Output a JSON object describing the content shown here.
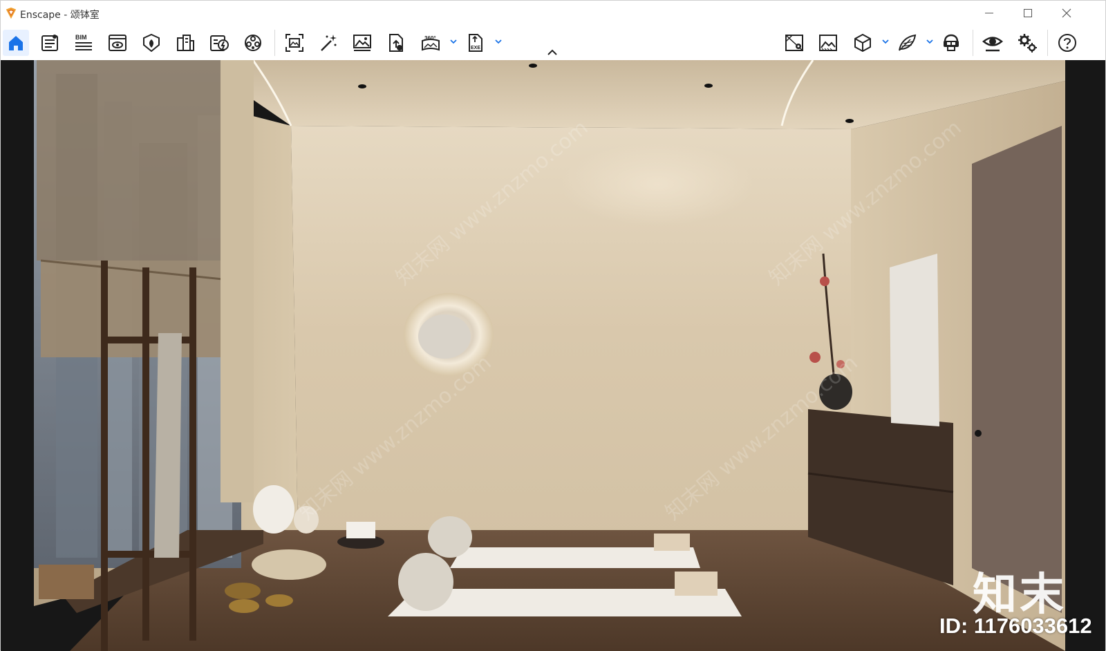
{
  "window": {
    "app_name": "Enscape",
    "title": "Enscape - 颂钵室",
    "controls": {
      "minimize": "minimize-icon",
      "maximize": "maximize-icon",
      "close": "close-icon"
    }
  },
  "toolbar": {
    "left_tools": [
      {
        "name": "home-icon",
        "label": "",
        "active": true
      },
      {
        "name": "notes-icon",
        "label": ""
      },
      {
        "name": "bim-icon",
        "label": "BIM"
      },
      {
        "name": "views-icon",
        "label": ""
      },
      {
        "name": "sites-icon",
        "label": ""
      },
      {
        "name": "asset-library-icon",
        "label": ""
      },
      {
        "name": "material-editor-icon",
        "label": ""
      },
      {
        "name": "video-editor-icon",
        "label": ""
      },
      {
        "name": "screenshot-icon",
        "label": ""
      },
      {
        "name": "batch-render-icon",
        "label": ""
      },
      {
        "name": "render-gallery-icon",
        "label": ""
      },
      {
        "name": "upload-icon",
        "label": ""
      },
      {
        "name": "panorama-360-icon",
        "label": "360°"
      },
      {
        "name": "export-exe-icon",
        "label": "EXE"
      }
    ],
    "right_tools": [
      {
        "name": "map-icon"
      },
      {
        "name": "capture-icon"
      },
      {
        "name": "cube-icon"
      },
      {
        "name": "feather-icon"
      },
      {
        "name": "vr-headset-icon"
      },
      {
        "name": "visibility-icon"
      },
      {
        "name": "settings-icon"
      },
      {
        "name": "help-icon"
      }
    ],
    "accent_color": "#1a73e8"
  },
  "viewport": {
    "scene": "yoga / singing bowl room rendering",
    "watermark_logo": "知末",
    "watermark_id": "ID: 1176033612",
    "watermark_diag": "知末网 www.znzmo.com"
  }
}
